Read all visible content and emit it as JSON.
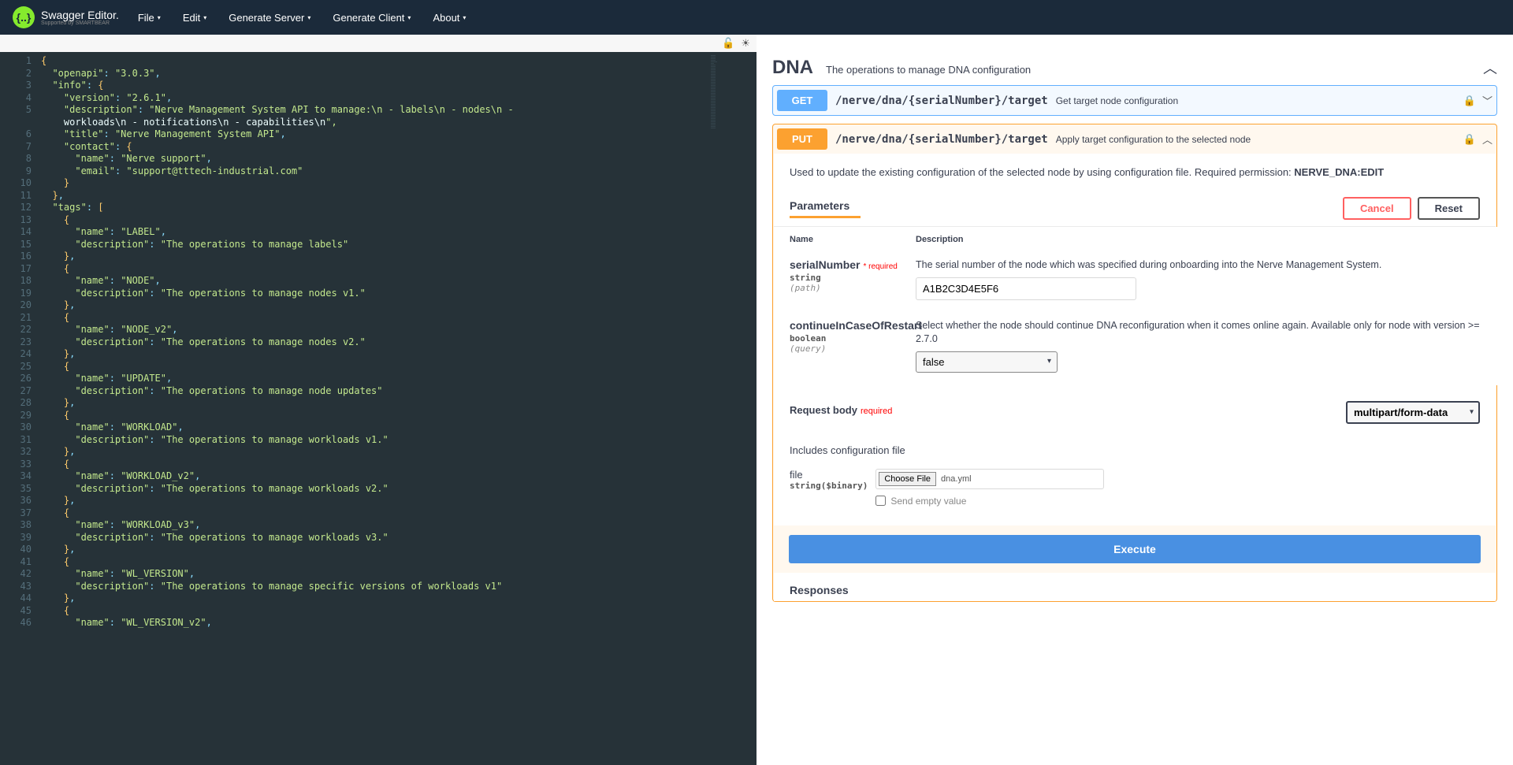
{
  "topbar": {
    "logo_main": "Swagger Editor.",
    "logo_sub": "Supported by SMARTBEAR",
    "menu": [
      "File",
      "Edit",
      "Generate Server",
      "Generate Client",
      "About"
    ]
  },
  "editor_tools": {
    "lock": "🔓",
    "theme": "☀"
  },
  "code_lines": [
    "{",
    "  \"openapi\": \"3.0.3\",",
    "  \"info\": {",
    "    \"version\": \"2.6.1\",",
    "    \"description\": \"Nerve Management System API to manage:\\n - labels\\n - nodes\\n - workloads\\n - notifications\\n - capabilities\\n\",",
    "    \"title\": \"Nerve Management System API\",",
    "    \"contact\": {",
    "      \"name\": \"Nerve support\",",
    "      \"email\": \"support@tttech-industrial.com\"",
    "    }",
    "  },",
    "  \"tags\": [",
    "    {",
    "      \"name\": \"LABEL\",",
    "      \"description\": \"The operations to manage labels\"",
    "    },",
    "    {",
    "      \"name\": \"NODE\",",
    "      \"description\": \"The operations to manage nodes v1.\"",
    "    },",
    "    {",
    "      \"name\": \"NODE_v2\",",
    "      \"description\": \"The operations to manage nodes v2.\"",
    "    },",
    "    {",
    "      \"name\": \"UPDATE\",",
    "      \"description\": \"The operations to manage node updates\"",
    "    },",
    "    {",
    "      \"name\": \"WORKLOAD\",",
    "      \"description\": \"The operations to manage workloads v1.\"",
    "    },",
    "    {",
    "      \"name\": \"WORKLOAD_v2\",",
    "      \"description\": \"The operations to manage workloads v2.\"",
    "    },",
    "    {",
    "      \"name\": \"WORKLOAD_v3\",",
    "      \"description\": \"The operations to manage workloads v3.\"",
    "    },",
    "    {",
    "      \"name\": \"WL_VERSION\",",
    "      \"description\": \"The operations to manage specific versions of workloads v1\"",
    "    },",
    "    {",
    "      \"name\": \"WL_VERSION_v2\","
  ],
  "tag": {
    "name": "DNA",
    "desc": "The operations to manage DNA configuration"
  },
  "ops": {
    "get": {
      "method": "GET",
      "path": "/nerve/dna/{serialNumber}/target",
      "summary": "Get target node configuration"
    },
    "put": {
      "method": "PUT",
      "path": "/nerve/dna/{serialNumber}/target",
      "summary": "Apply target configuration to the selected node",
      "description_pre": "Used to update the existing configuration of the selected node by using configuration file. Required permission: ",
      "description_perm": "NERVE_DNA:EDIT"
    }
  },
  "params": {
    "title": "Parameters",
    "cancel": "Cancel",
    "reset": "Reset",
    "th_name": "Name",
    "th_desc": "Description",
    "serial": {
      "name": "serialNumber",
      "req": "* required",
      "type": "string",
      "in": "(path)",
      "desc": "The serial number of the node which was specified during onboarding into the Nerve Management System.",
      "value": "A1B2C3D4E5F6"
    },
    "cont": {
      "name": "continueInCaseOfRestart",
      "type": "boolean",
      "in": "(query)",
      "desc": "Select whether the node should continue DNA reconfiguration when it comes online again. Available only for node with version >= 2.7.0",
      "value": "false"
    }
  },
  "body": {
    "title": "Request body",
    "req": "required",
    "content_type": "multipart/form-data",
    "desc": "Includes configuration file",
    "file_label": "file",
    "file_type": "string($binary)",
    "choose": "Choose File",
    "filename": "dna.yml",
    "empty": "Send empty value"
  },
  "execute": "Execute",
  "responses": "Responses"
}
